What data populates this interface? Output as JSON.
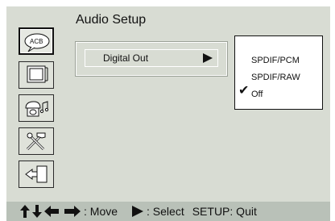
{
  "menu": {
    "title": "Audio Setup"
  },
  "sidebar": {
    "icons": [
      {
        "name": "audio-language-icon",
        "label": "ACB",
        "active": true
      },
      {
        "name": "video-screen-icon",
        "active": false
      },
      {
        "name": "audio-speaker-icon",
        "active": false
      },
      {
        "name": "preferences-tools-icon",
        "active": false
      },
      {
        "name": "exit-icon",
        "active": false
      }
    ]
  },
  "item": {
    "label": "Digital Out"
  },
  "submenu": {
    "options": [
      "SPDIF/PCM",
      "SPDIF/RAW",
      "Off"
    ],
    "selected": "Off"
  },
  "footer": {
    "move_label": ": Move",
    "select_label": ": Select",
    "quit_label": "SETUP: Quit"
  }
}
